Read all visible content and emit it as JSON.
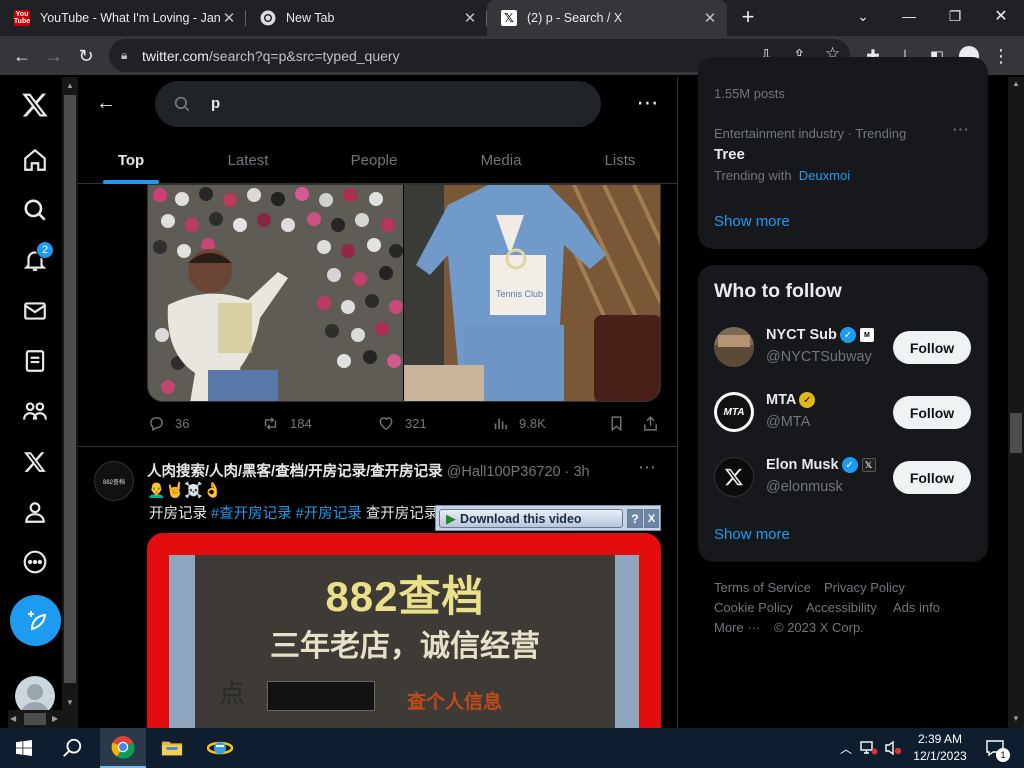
{
  "browser": {
    "tabs": [
      {
        "title": "YouTube - What I'm Loving - Jan",
        "favicon": "youtube-icon"
      },
      {
        "title": "New Tab",
        "favicon": "chrome-icon"
      },
      {
        "title": "(2) p - Search / X",
        "favicon": "x-icon"
      }
    ],
    "url_domain": "twitter.com",
    "url_path": "/search?q=p&src=typed_query"
  },
  "nav": {
    "notification_count": "2"
  },
  "search": {
    "query": "p"
  },
  "search_tabs": [
    "Top",
    "Latest",
    "People",
    "Media",
    "Lists"
  ],
  "tweet1": {
    "image_overlay": "Tennis Club",
    "replies": "36",
    "reposts": "184",
    "likes": "321",
    "views": "9.8K"
  },
  "tweet2": {
    "avatar_text": "882查档",
    "name": "人肉搜索/人肉/黑客/查档/开房记录/查开房记录",
    "handle": "@Hall100P36720",
    "time": "· 3h",
    "emojis": "👨‍🦲🤘☠️👌",
    "text": "开房记录",
    "hashtag1": "#查开房记录",
    "hashtag2": "#开房记录",
    "text_end": "查开房记录",
    "video_line1": "882查档",
    "video_line2": "三年老店，诚信经营",
    "video_line3": "查个人信息",
    "video_left": "点"
  },
  "download_bar": {
    "label": "Download this video",
    "help": "?",
    "close": "X"
  },
  "trends": {
    "posts": "1.55M posts",
    "category": "Entertainment industry · Trending",
    "topic": "Tree",
    "trending_with_label": "Trending with",
    "trending_with": "Deuxmoi",
    "show_more": "Show more"
  },
  "who_to_follow": {
    "title": "Who to follow",
    "accounts": [
      {
        "name": "NYCT Sub",
        "handle": "@NYCTSubway",
        "button": "Follow"
      },
      {
        "name": "MTA",
        "handle": "@MTA",
        "button": "Follow"
      },
      {
        "name": "Elon Musk",
        "handle": "@elonmusk",
        "button": "Follow"
      }
    ],
    "show_more": "Show more"
  },
  "footer": {
    "links": [
      "Terms of Service",
      "Privacy Policy",
      "Cookie Policy",
      "Accessibility",
      "Ads info",
      "More ···"
    ],
    "copyright": "© 2023 X Corp."
  },
  "taskbar": {
    "time": "2:39 AM",
    "date": "12/1/2023",
    "notif_count": "1"
  },
  "colors": {
    "accent": "#1d9bf0",
    "background": "#000000",
    "card": "#16181c",
    "gold_check": "#e2b719"
  }
}
